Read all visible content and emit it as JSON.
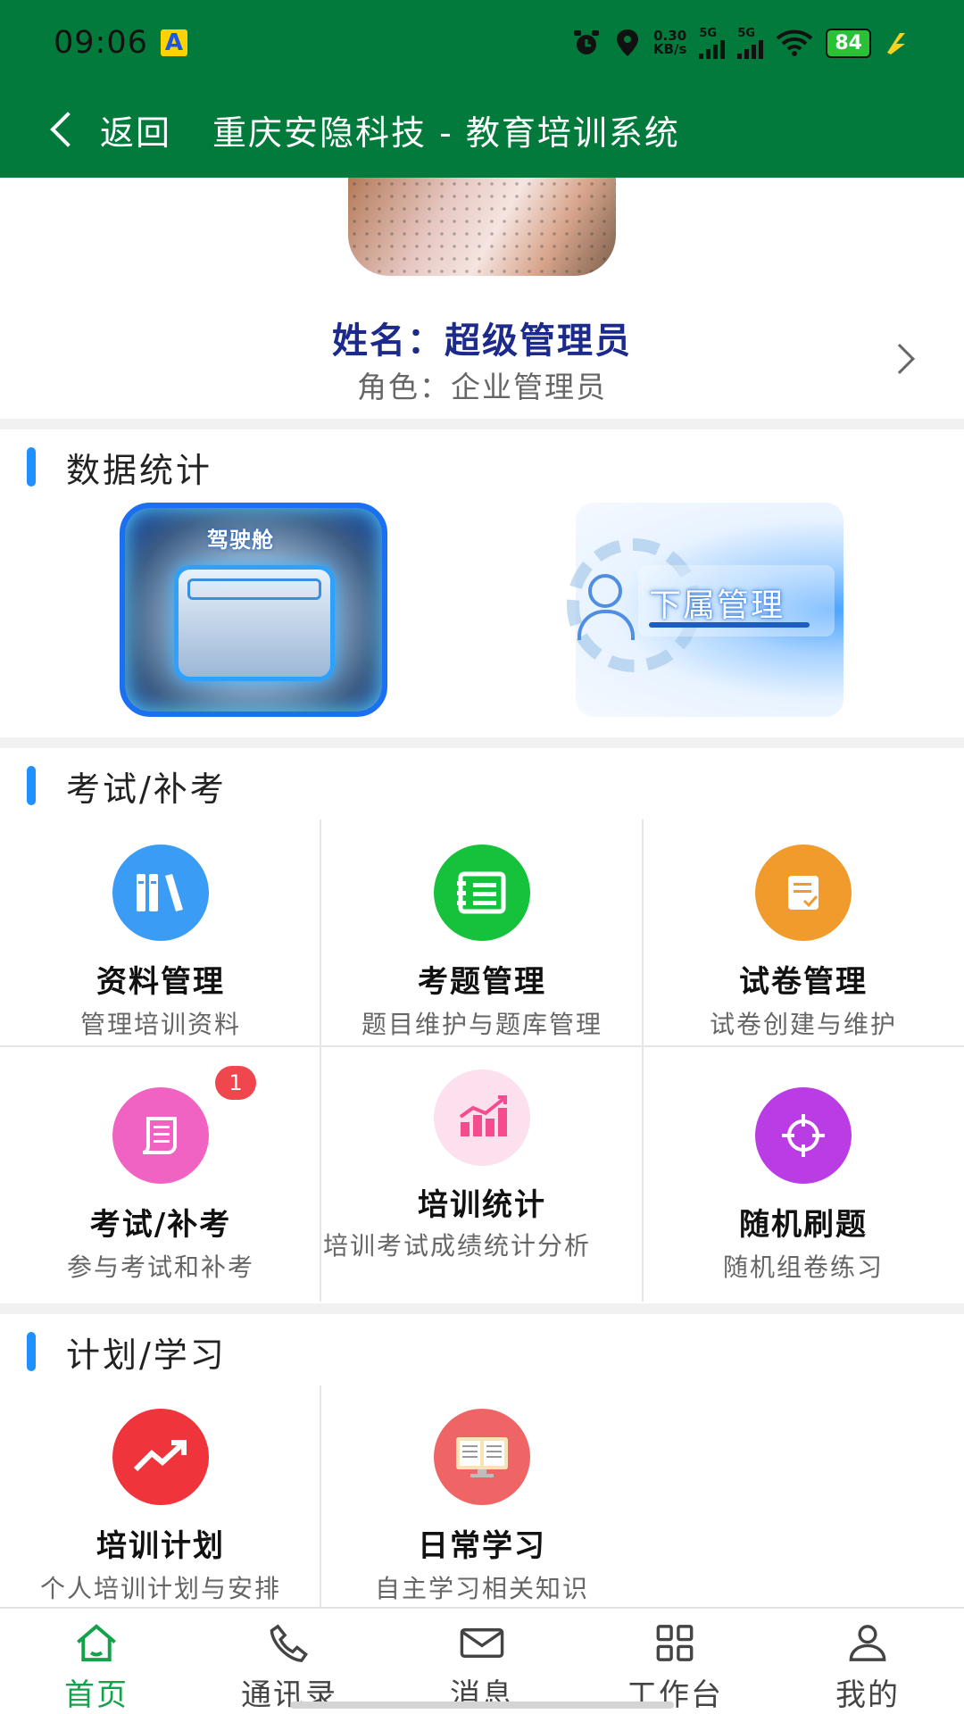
{
  "status_bar": {
    "time": "09:06",
    "app_badge": "A",
    "net_speed_value": "0.30",
    "net_speed_unit": "KB/s",
    "sim1_label": "5G",
    "sim2_label": "5G",
    "battery": "84"
  },
  "nav": {
    "back_label": "返回",
    "title": "重庆安隐科技 - 教育培训系统"
  },
  "profile": {
    "name": "姓名：超级管理员",
    "role": "角色：企业管理员"
  },
  "sections": {
    "stats": {
      "title": "数据统计",
      "tiles": [
        "驾驶舱",
        "下属管理"
      ]
    },
    "exam": {
      "title": "考试/补考",
      "items": [
        {
          "title": "资料管理",
          "subtitle": "管理培训资料",
          "icon": "books-icon",
          "color": "#3b9cf5"
        },
        {
          "title": "考题管理",
          "subtitle": "题目维护与题库管理",
          "icon": "question-bank-icon",
          "color": "#16c23c"
        },
        {
          "title": "试卷管理",
          "subtitle": "试卷创建与维护",
          "icon": "exam-paper-icon",
          "color": "#f19b2c"
        },
        {
          "title": "考试/补考",
          "subtitle": "参与考试和补考",
          "icon": "scroll-icon",
          "color": "#f163c3",
          "badge": "1"
        },
        {
          "title": "培训统计",
          "subtitle": "培训考试成绩统计分析",
          "icon": "chart-icon",
          "color": "#f54b8f"
        },
        {
          "title": "随机刷题",
          "subtitle": "随机组卷练习",
          "icon": "target-icon",
          "color": "#b93ce4"
        }
      ]
    },
    "plan": {
      "title": "计划/学习",
      "items": [
        {
          "title": "培训计划",
          "subtitle": "个人培训计划与安排",
          "icon": "trend-up-icon",
          "color": "#f0343c"
        },
        {
          "title": "日常学习",
          "subtitle": "自主学习相关知识",
          "icon": "open-book-icon",
          "color": "#ef6565"
        }
      ]
    }
  },
  "tabbar": [
    {
      "label": "首页",
      "icon": "home-icon",
      "active": true
    },
    {
      "label": "通讯录",
      "icon": "phone-icon",
      "active": false
    },
    {
      "label": "消息",
      "icon": "mail-icon",
      "active": false
    },
    {
      "label": "工作台",
      "icon": "grid-icon",
      "active": false
    },
    {
      "label": "我的",
      "icon": "user-icon",
      "active": false
    }
  ],
  "colors": {
    "header": "#027a3b",
    "accent_active": "#13a24a",
    "section_bar": "#1e90ff",
    "name_text": "#1c2a8c"
  }
}
